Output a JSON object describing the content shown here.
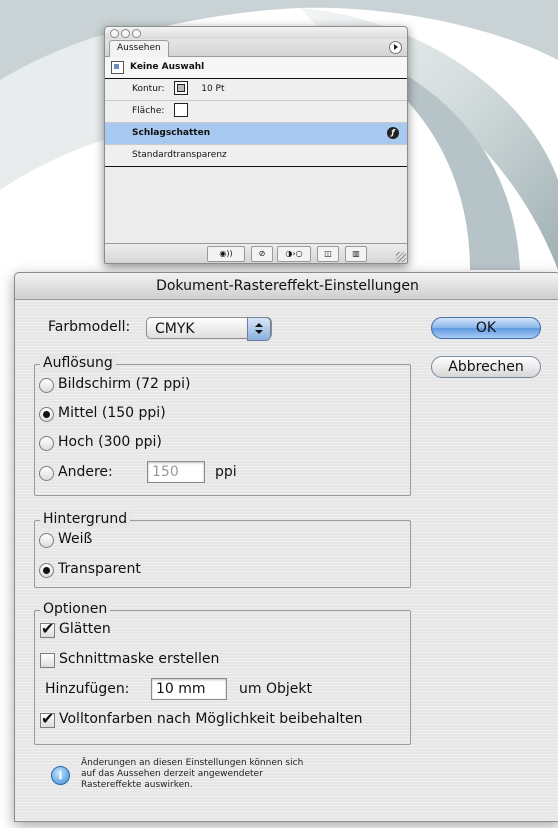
{
  "appearance_panel": {
    "tab_label": "Aussehen",
    "header_label": "Keine Auswahl",
    "rows": [
      {
        "label": "Kontur:",
        "value": "10 Pt",
        "swatch": "stroke"
      },
      {
        "label": "Fläche:",
        "value": "",
        "swatch": "fill"
      },
      {
        "label": "Schlagschatten",
        "icon": "fx-icon",
        "highlighted": true
      },
      {
        "label": "Standardtransparenz"
      }
    ],
    "footer_buttons": [
      {
        "icon": "visibility-toggle-icon",
        "glyph": "◉))"
      },
      {
        "icon": "clear-appearance-icon",
        "glyph": "⊘"
      },
      {
        "icon": "reduce-to-basic-icon",
        "glyph": "◑›○"
      },
      {
        "icon": "duplicate-item-icon",
        "glyph": "◫"
      },
      {
        "icon": "delete-item-icon",
        "glyph": "🗑"
      }
    ]
  },
  "dialog": {
    "title": "Dokument-Rastereffekt-Einstellungen",
    "color_model_label": "Farbmodell:",
    "color_model_value": "CMYK",
    "ok_label": "OK",
    "cancel_label": "Abbrechen",
    "resolution": {
      "legend": "Auflösung",
      "options": [
        {
          "label": "Bildschirm (72 ppi)",
          "selected": false
        },
        {
          "label": "Mittel (150 ppi)",
          "selected": true
        },
        {
          "label": "Hoch (300 ppi)",
          "selected": false
        },
        {
          "label": "Andere:",
          "selected": false
        }
      ],
      "other_value": "150",
      "other_unit": "ppi"
    },
    "background": {
      "legend": "Hintergrund",
      "options": [
        {
          "label": "Weiß",
          "selected": false
        },
        {
          "label": "Transparent",
          "selected": true
        }
      ]
    },
    "options": {
      "legend": "Optionen",
      "antialias": {
        "label": "Glätten",
        "checked": true
      },
      "clipping_mask": {
        "label": "Schnittmaske erstellen",
        "checked": false
      },
      "add_label": "Hinzufügen:",
      "add_value": "10 mm",
      "add_suffix": "um Objekt",
      "preserve_spot": {
        "label": "Volltonfarben nach Möglichkeit beibehalten",
        "checked": true
      }
    },
    "note_lines": [
      "Änderungen an diesen Einstellungen können sich",
      "auf das Aussehen derzeit angewendeter",
      "Rastereffekte auswirken."
    ]
  },
  "colors": {
    "highlight": "#a7c9ef",
    "default_button": "#5e98e0",
    "backdrop_swoosh": "#cfd8da"
  }
}
